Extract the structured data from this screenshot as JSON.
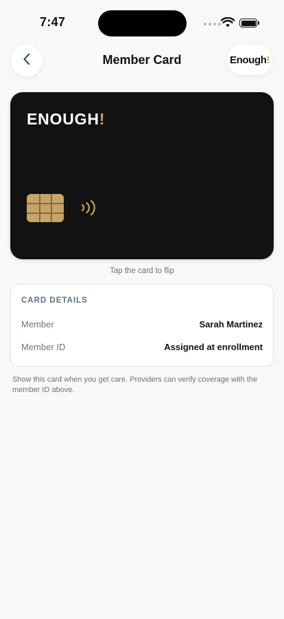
{
  "status_bar": {
    "time": "7:47"
  },
  "header": {
    "title": "Member Card",
    "logo_text": "Enough",
    "logo_mark": "!",
    "back_icon": "chevron-left-icon"
  },
  "card": {
    "brand_text": "ENOUGH",
    "brand_mark": "!",
    "accent_color": "#c9a35d",
    "background_color": "#121212",
    "chip_icon": "chip-icon",
    "contactless_icon": "contactless-icon"
  },
  "flip_hint": "Tap the card to flip",
  "details": {
    "heading": "CARD DETAILS",
    "rows": [
      {
        "label": "Member",
        "value": "Sarah Martinez"
      },
      {
        "label": "Member ID",
        "value": "Assigned at enrollment"
      }
    ]
  },
  "footnote": "Show this card when you get care. Providers can verify coverage with the member ID above."
}
